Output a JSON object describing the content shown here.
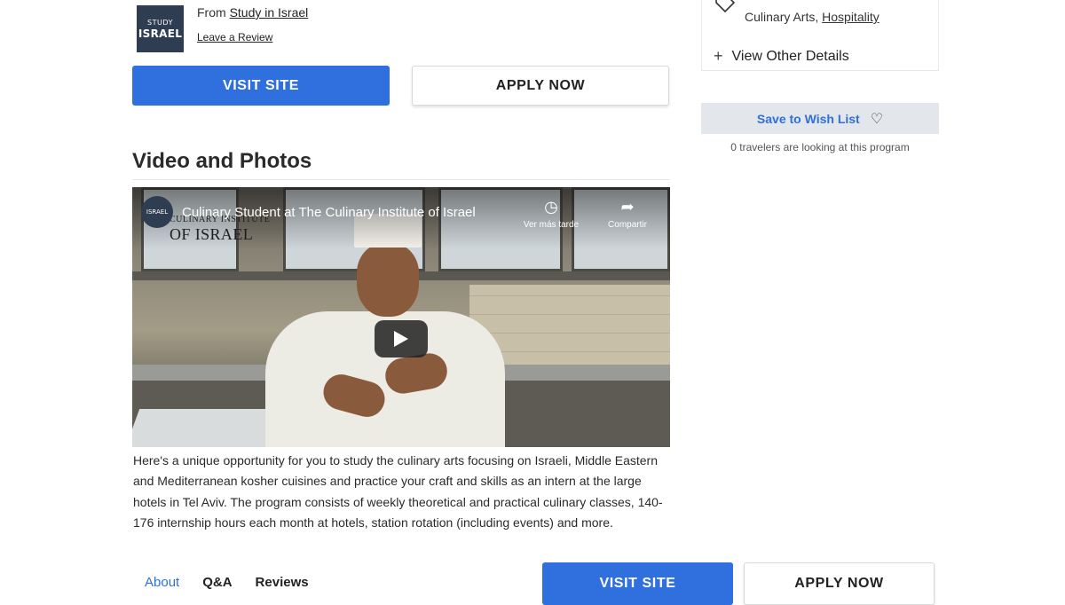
{
  "provider": {
    "logo_line1": "STUDY",
    "logo_line2": "ISRAEL",
    "from_prefix": "From",
    "name": "Study in Israel",
    "review_link": "Leave a Review"
  },
  "cta_top": {
    "visit": "VISIT SITE",
    "apply": "APPLY NOW"
  },
  "section": {
    "title": "Video and Photos"
  },
  "video": {
    "title": "Culinary Student at The Culinary Institute of Israel",
    "overlay_line1": "CULINARY INSTITUTE",
    "overlay_line2": "OF ISRAEL",
    "watch_later": "Ver más tarde",
    "share": "Compartir"
  },
  "description": "Here's a unique opportunity for you to study the culinary arts focusing on Israeli, Middle Eastern and Mediterranean kosher cuisines and practice your craft and skills as an intern at the large hotels in Tel Aviv. The program consists of weekly theoretical and practical culinary classes, 140-176 internship hours each month at hotels, station rotation (including events) and more.",
  "tabs": [
    {
      "label": "About",
      "active": true
    },
    {
      "label": "Q&A",
      "active": false
    },
    {
      "label": "Reviews",
      "active": false
    }
  ],
  "cta_bottom": {
    "visit": "VISIT SITE",
    "apply": "APPLY NOW"
  },
  "sidebar": {
    "categories_plain": "Culinary Arts, ",
    "categories_link": "Hospitality",
    "other_details": "View Other Details",
    "wishlist": "Save to Wish List",
    "travelers": "0 travelers are looking at this program"
  },
  "colors": {
    "primary": "#2f6fde",
    "wish_bg": "#e3e6ea"
  }
}
